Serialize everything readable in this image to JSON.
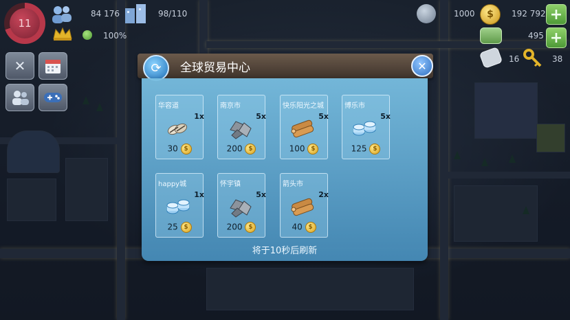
{
  "hud": {
    "level": "11",
    "population": "84 176",
    "workers": "98/110",
    "happiness": "100%",
    "simoleons_gold": "1000",
    "simoleons": "192 792",
    "cash": "495",
    "items_count": "16",
    "keys": "38"
  },
  "dialog": {
    "title": "全球贸易中心",
    "refresh_note": "将于10秒后刷新",
    "offers": [
      {
        "city": "华容道",
        "qty": "1x",
        "price": "30",
        "resource": "seeds"
      },
      {
        "city": "南京市",
        "qty": "5x",
        "price": "200",
        "resource": "metal"
      },
      {
        "city": "快乐阳光之城",
        "qty": "5x",
        "price": "100",
        "resource": "wood"
      },
      {
        "city": "博乐市",
        "qty": "5x",
        "price": "125",
        "resource": "plastic"
      },
      {
        "city": "happy城",
        "qty": "1x",
        "price": "25",
        "resource": "plastic"
      },
      {
        "city": "怀宇镇",
        "qty": "5x",
        "price": "200",
        "resource": "metal"
      },
      {
        "city": "箭头市",
        "qty": "2x",
        "price": "40",
        "resource": "wood"
      }
    ]
  },
  "colors": {
    "panel": "#6fb3d9",
    "header": "#55473b",
    "accent_blue": "#2f6fbf",
    "plus_green": "#5faa44",
    "coin_gold": "#e3b42a"
  }
}
